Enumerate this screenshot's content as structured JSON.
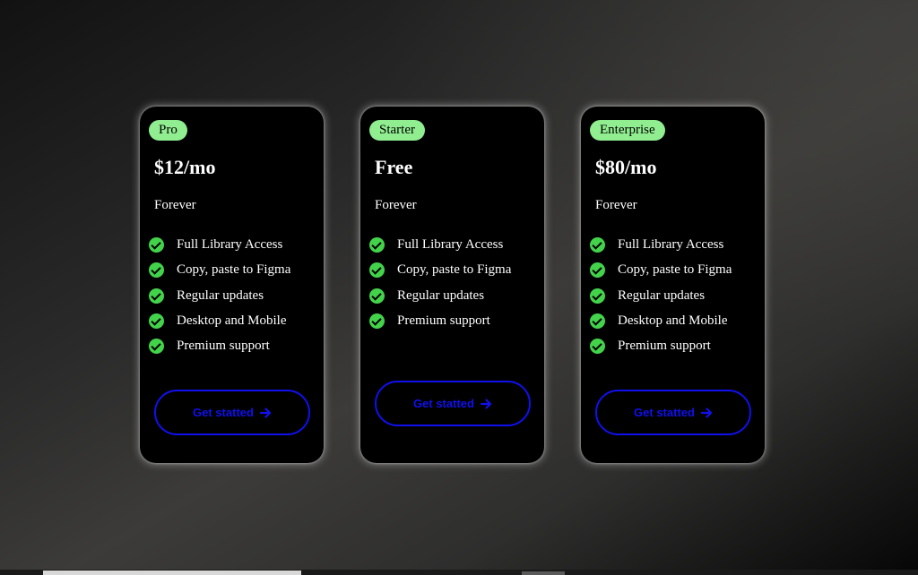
{
  "cards": [
    {
      "badge": "Pro",
      "price": "$12/mo",
      "period": "Forever",
      "features": [
        "Full Library Access",
        "Copy, paste to Figma",
        "Regular updates",
        "Desktop and Mobile",
        "Premium support"
      ],
      "cta": "Get statted",
      "cta_icon": "arrow-right-icon"
    },
    {
      "badge": "Starter",
      "price": "Free",
      "period": "Forever",
      "features": [
        "Full Library Access",
        "Copy, paste to Figma",
        "Regular updates",
        "Premium support"
      ],
      "cta": "Get statted",
      "cta_icon": "arrow-right-icon"
    },
    {
      "badge": "Enterprise",
      "price": "$80/mo",
      "period": "Forever",
      "features": [
        "Full Library Access",
        "Copy, paste to Figma",
        "Regular updates",
        "Desktop and Mobile",
        "Premium support"
      ],
      "cta": "Get statted",
      "cta_icon": "arrow-right-icon"
    }
  ],
  "colors": {
    "card_bg": "#000000",
    "badge_bg": "#90ee90",
    "check": "#43d34b",
    "cta": "#1010ee",
    "text": "#ffffff"
  }
}
